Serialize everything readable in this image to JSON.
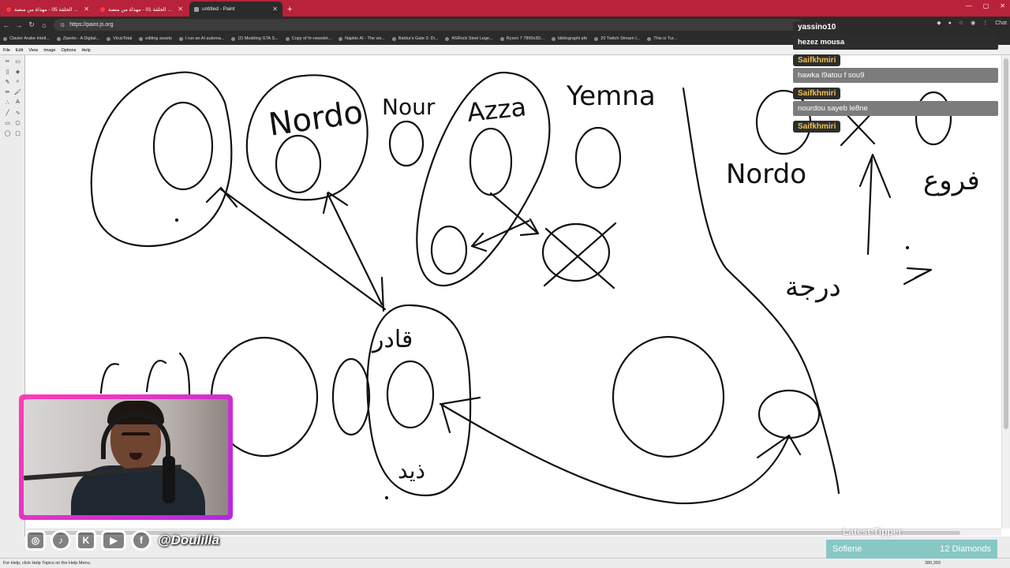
{
  "browser": {
    "tabs": [
      {
        "title": "خطيفة الحلقة 05 - مهداة من منصة",
        "active": false,
        "favicon": "youtube-icon"
      },
      {
        "title": "خطيفة الحلقة 01 - مهداة من منصة",
        "active": false,
        "favicon": "youtube-icon"
      },
      {
        "title": "untitled - Paint",
        "active": true,
        "favicon": "paint-icon"
      }
    ],
    "new_tab_symbol": "+",
    "url": "https://paint.js.org",
    "bookmarks": [
      "Clavier Arabe Intell...",
      "Ziperto - A Digital...",
      "VirusTotal",
      "editing assets",
      "I run an AI automa...",
      "(2) Modding GTA S...",
      "Copy of hr-newslet...",
      "Napkin AI - The vis...",
      "Baldur's Gate 3: Di...",
      "ASRock Steel Lege...",
      "Ryzen 7 7800x3D...",
      "bibliographi pfe",
      "20 Twitch Stream I...",
      "This is Tur..."
    ],
    "extension_label": "Chat"
  },
  "paint": {
    "menu": [
      "File",
      "Edit",
      "View",
      "Image",
      "Options",
      "Help"
    ],
    "status_text": "For Help, click Help Topics on the Help Menu.",
    "coords": "380,399",
    "tools": [
      "select-free",
      "select-rect",
      "eraser",
      "fill",
      "color-picker",
      "magnifier",
      "pencil",
      "brush",
      "airbrush",
      "text",
      "line",
      "curve",
      "rectangle",
      "polygon",
      "ellipse",
      "rounded-rect"
    ]
  },
  "drawing_text": {
    "nordo_top": "Nordo",
    "nour": "Nour",
    "azza": "Azza",
    "yemna": "Yemna",
    "nordo_right": "Nordo",
    "arabic_right": "فروع",
    "arabic_bottom_right": "درجة",
    "arabic_center": "قادر",
    "arabic_center_bottom": "ذيد"
  },
  "chat": {
    "messages": [
      {
        "user": "yassino10",
        "text": "hezez mousa"
      },
      {
        "user": "Saifkhmiri",
        "text": "hawka l9atou f sou9"
      },
      {
        "user": "Saifkhmiri",
        "text": "nourdou sayeb le8ne"
      },
      {
        "user": "Saifkhmiri",
        "text": ""
      }
    ]
  },
  "overlay": {
    "handle": "@Doulilla",
    "latest_tipper_label": "Latest Tipper",
    "tipper_name": "Sofiene",
    "tipper_amount": "12 Diamonds"
  },
  "colors": {
    "tab_strip": "#b8223a",
    "browser_chrome": "#2b2b2b",
    "webcam_border": "#e63bc8",
    "chat_name": "#f2c14e",
    "tipper_bg": "#7fc5c1"
  }
}
